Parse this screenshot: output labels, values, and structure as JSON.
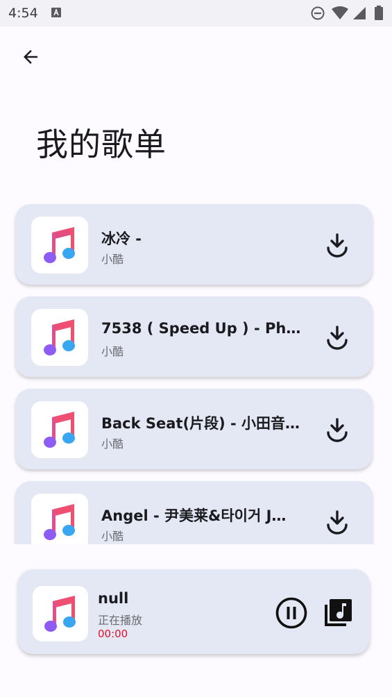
{
  "status_bar": {
    "time": "4:54",
    "icons": [
      "text-a-icon",
      "do-not-disturb-icon",
      "wifi-icon",
      "cell-signal-icon",
      "battery-icon"
    ]
  },
  "header": {
    "back_icon": "arrow-left-icon",
    "title": "我的歌单"
  },
  "playlist": [
    {
      "title": "冰冷 -",
      "artist": "小酷"
    },
    {
      "title": "7538 ( Speed Up ) - Pha…",
      "artist": "小酷"
    },
    {
      "title": "Back Seat(片段) - 小田音…",
      "artist": "小酷"
    },
    {
      "title": "Angel - 尹美莱&타이거 J…",
      "artist": "小酷"
    }
  ],
  "player": {
    "title": "null",
    "status": "正在播放",
    "time": "00:00",
    "pause_icon": "pause-circle-icon",
    "library_icon": "music-library-icon"
  },
  "colors": {
    "card_bg": "#e3e8f4",
    "time_red": "#e0102a",
    "note_pink": "#f0506e",
    "note_purple": "#8e5cf5",
    "note_blue": "#38a6f0"
  }
}
